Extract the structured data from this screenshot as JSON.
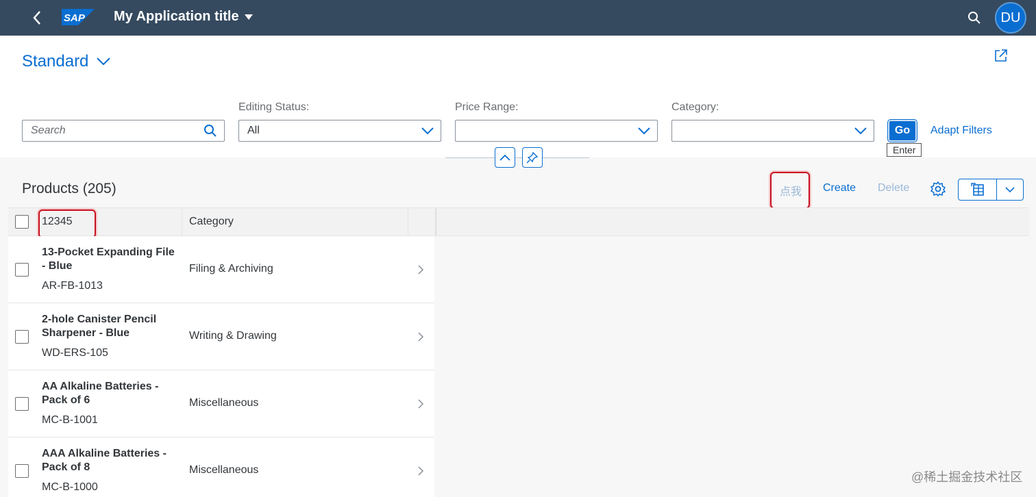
{
  "shell": {
    "logo_text": "SAP",
    "app_title": "My Application title",
    "avatar_initials": "DU"
  },
  "header": {
    "variant_name": "Standard"
  },
  "filters": {
    "search_placeholder": "Search",
    "editing_status": {
      "label": "Editing Status:",
      "value": "All"
    },
    "price_range": {
      "label": "Price Range:",
      "value": ""
    },
    "category": {
      "label": "Category:",
      "value": ""
    },
    "go_label": "Go",
    "go_tooltip": "Enter",
    "adapt_filters_label": "Adapt Filters"
  },
  "table": {
    "title": "Products (205)",
    "toolbar": {
      "custom_button": "点我",
      "create": "Create",
      "delete": "Delete"
    },
    "columns": [
      "12345",
      "Category"
    ],
    "rows": [
      {
        "name": "13-Pocket Expanding File - Blue",
        "id": "AR-FB-1013",
        "category": "Filing & Archiving"
      },
      {
        "name": "2-hole Canister Pencil Sharpener - Blue",
        "id": "WD-ERS-105",
        "category": "Writing & Drawing"
      },
      {
        "name": "AA Alkaline Batteries - Pack of 6",
        "id": "MC-B-1001",
        "category": "Miscellaneous"
      },
      {
        "name": "AAA Alkaline Batteries - Pack of 8",
        "id": "MC-B-1000",
        "category": "Miscellaneous"
      }
    ]
  },
  "watermark": "@稀土掘金技术社区",
  "colors": {
    "shell_bg": "#354a5f",
    "accent": "#0a6ed1",
    "highlight": "#c8101e"
  }
}
